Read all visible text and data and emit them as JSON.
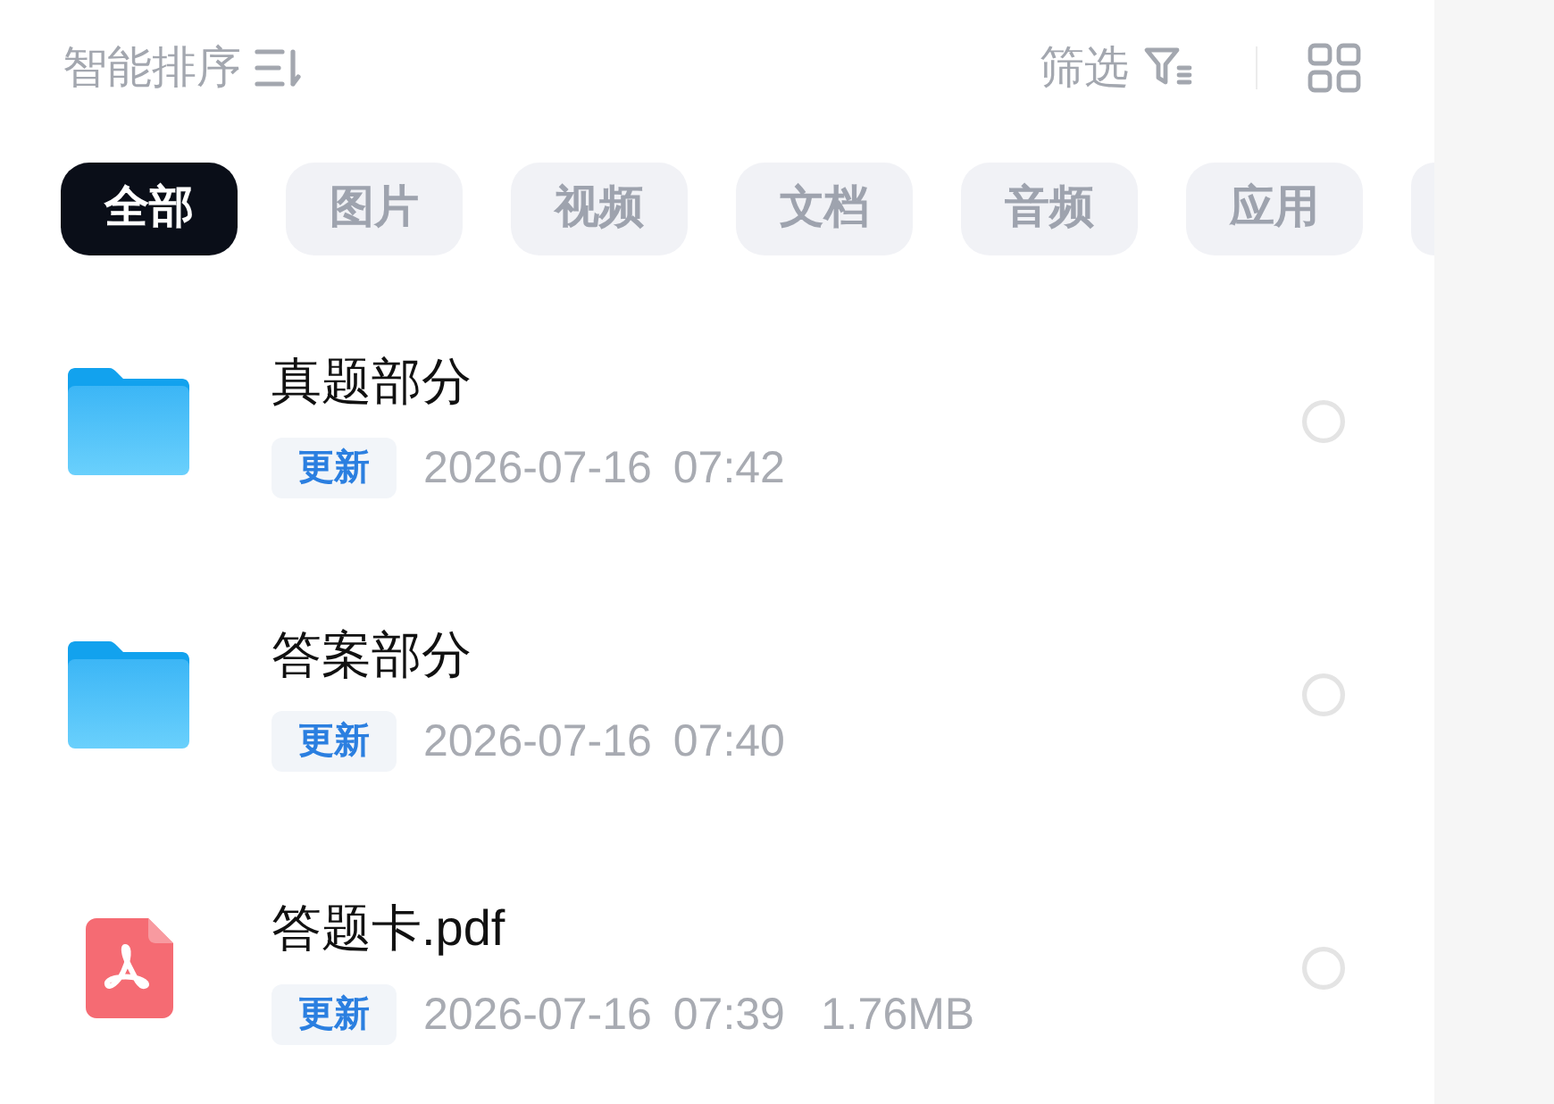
{
  "toolbar": {
    "sort_label": "智能排序",
    "filter_label": "筛选"
  },
  "tabs": [
    {
      "label": "全部",
      "selected": true
    },
    {
      "label": "图片",
      "selected": false
    },
    {
      "label": "视频",
      "selected": false
    },
    {
      "label": "文档",
      "selected": false
    },
    {
      "label": "音频",
      "selected": false
    },
    {
      "label": "应用",
      "selected": false
    },
    {
      "selected": false
    }
  ],
  "files": [
    {
      "kind": "folder",
      "name": "真题部分",
      "badge": "更新",
      "date": "2026-07-16",
      "time": "07:42",
      "selected": false
    },
    {
      "kind": "folder",
      "name": "答案部分",
      "badge": "更新",
      "date": "2026-07-16",
      "time": "07:40",
      "selected": false
    },
    {
      "kind": "pdf",
      "name": "答题卡.pdf",
      "badge": "更新",
      "date": "2026-07-16",
      "time": "07:39",
      "size": "1.76MB",
      "selected": false
    }
  ]
}
